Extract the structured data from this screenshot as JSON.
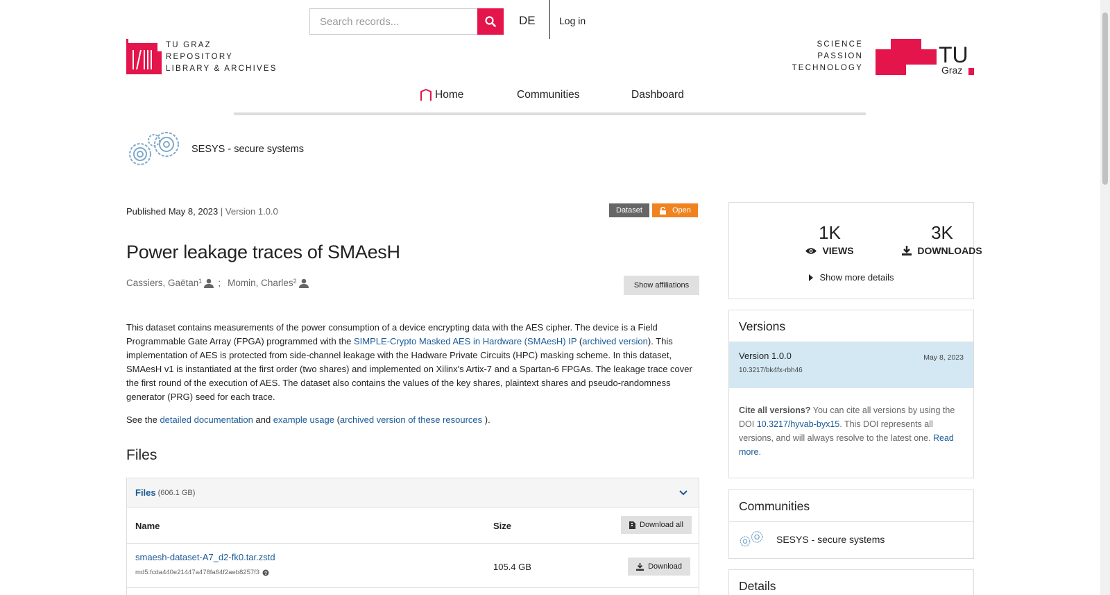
{
  "header": {
    "search_placeholder": "Search records...",
    "lang": "DE",
    "login": "Log in",
    "brand_line1": "TU GRAZ",
    "brand_line2": "REPOSITORY",
    "brand_line3": "LIBRARY & ARCHIVES",
    "motto1": "SCIENCE",
    "motto2": "PASSION",
    "motto3": "TECHNOLOGY",
    "tu_text": "TU",
    "graz_text": "Graz"
  },
  "nav": {
    "home": "Home",
    "communities": "Communities",
    "dashboard": "Dashboard"
  },
  "community": {
    "name": "SESYS - secure systems"
  },
  "record": {
    "published": "Published May 8, 2023",
    "version": "| Version 1.0.0",
    "badge_type": "Dataset",
    "badge_access": "Open",
    "title": "Power leakage traces of SMAesH",
    "author1": "Cassiers, Gaëtan",
    "author1_sup": "1",
    "separator": ";",
    "author2": "Momin, Charles",
    "author2_sup": "2",
    "show_affiliations": "Show affiliations",
    "desc_part1": "This dataset contains measurements of the power consumption of a device encrypting data with the AES cipher. The device is a Field Programmable Gate Array (FPGA) programmed with the ",
    "desc_link1": "SIMPLE-Crypto Masked AES in Hardware (SMAesH) IP",
    "desc_part2": " (",
    "desc_link2": "archived version",
    "desc_part3": ").  This implementation of AES is protected from side-channel leakage with the Hadware Private Circuits (HPC) masking scheme. In this dataset, SMAesH v1 is instantiated at the first order (two shares) and implemented on Xilinx's Artix-7 and a Spartan-6 FPGAs. The leakage trace cover the first round of the execution of AES. The dataset also contains the values of the key shares, plaintext shares and pseudo-randomness generator (PRG) seed for each trace.",
    "see_prefix": "See the ",
    "see_link1": "detailed documentation",
    "see_and": " and ",
    "see_link2": "example usage",
    "see_paren": " (",
    "see_link3": "archived version of these resources",
    "see_end": " )."
  },
  "files": {
    "heading": "Files",
    "panel_label": "Files",
    "panel_size": "(606.1 GB)",
    "col_name": "Name",
    "col_size": "Size",
    "download_all": "Download all",
    "rows": [
      {
        "name": "smaesh-dataset-A7_d2-fk0.tar.zstd",
        "md5": "md5:fcda440e21447a478fa64f2aeb8257f3",
        "size": "105.4 GB",
        "action": "Download"
      }
    ]
  },
  "stats": {
    "views_num": "1K",
    "views_label": "VIEWS",
    "downloads_num": "3K",
    "downloads_label": "DOWNLOADS",
    "more_details": "Show more details"
  },
  "versions": {
    "heading": "Versions",
    "active_version": "Version 1.0.0",
    "active_date": "May 8, 2023",
    "active_doi": "10.3217/bk4fx-rbh46",
    "cite_bold": "Cite all versions?",
    "cite_text1": " You can cite all versions by using the DOI ",
    "cite_doi": "10.3217/hyvab-byx15",
    "cite_text2": ". This DOI represents all versions, and will always resolve to the latest one. ",
    "cite_read_more": "Read more",
    "cite_end": "."
  },
  "communities_box": {
    "heading": "Communities",
    "item": "SESYS - secure systems"
  },
  "details_box": {
    "heading": "Details"
  },
  "colors": {
    "brand_red": "#e4154b",
    "open_orange": "#f08320",
    "link_blue": "#1a5a96",
    "active_version_bg": "#d3e8f3"
  }
}
